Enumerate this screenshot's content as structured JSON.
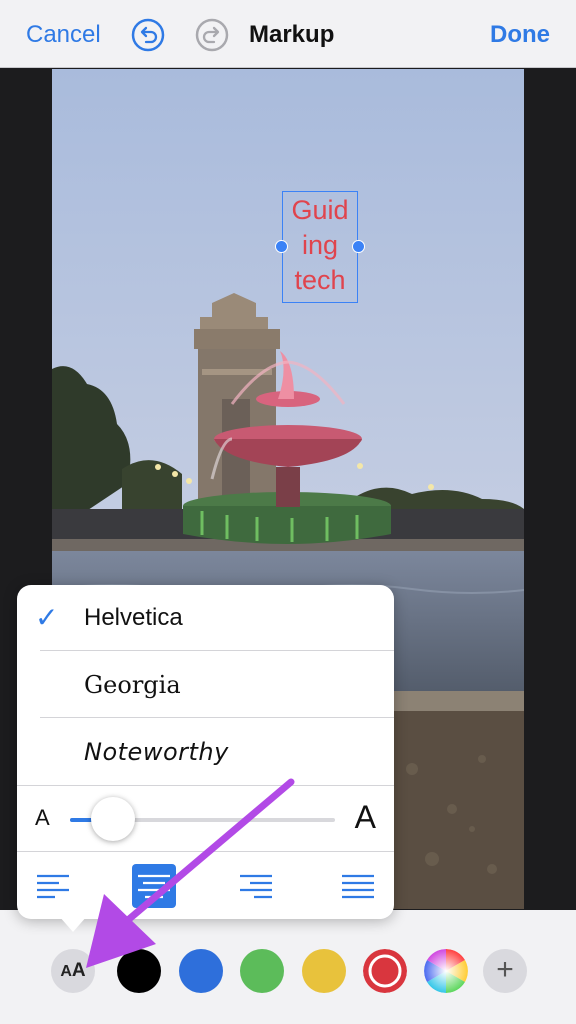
{
  "nav": {
    "cancel_label": "Cancel",
    "title": "Markup",
    "done_label": "Done"
  },
  "photo": {
    "annotation_text": [
      "Guid",
      "ing",
      "tech"
    ],
    "annotation_color": "#e0444d"
  },
  "font_menu": {
    "fonts": [
      {
        "label": "Helvetica",
        "selected": true
      },
      {
        "label": "Georgia",
        "selected": false
      },
      {
        "label": "Noteworthy",
        "selected": false
      }
    ],
    "check_glyph": "✓",
    "size_small_label": "A",
    "size_large_label": "A",
    "size_fraction": 0.17,
    "alignments": [
      "align-left",
      "align-center",
      "align-right",
      "align-justify"
    ],
    "selected_alignment": "align-center"
  },
  "toolbar": {
    "aa_label_small": "A",
    "aa_label_big": "A",
    "colors": [
      {
        "name": "black",
        "hex": "#000000"
      },
      {
        "name": "blue",
        "hex": "#2e6fdb"
      },
      {
        "name": "green",
        "hex": "#5cbc5a"
      },
      {
        "name": "yellow",
        "hex": "#e8c23c"
      },
      {
        "name": "red",
        "hex": "#d9363e",
        "selected": true
      }
    ],
    "color_wheel": "multicolor-wheel",
    "plus_label": "+"
  },
  "accent_color": "#2f7ae5",
  "arrow_color": "#b24ae6"
}
